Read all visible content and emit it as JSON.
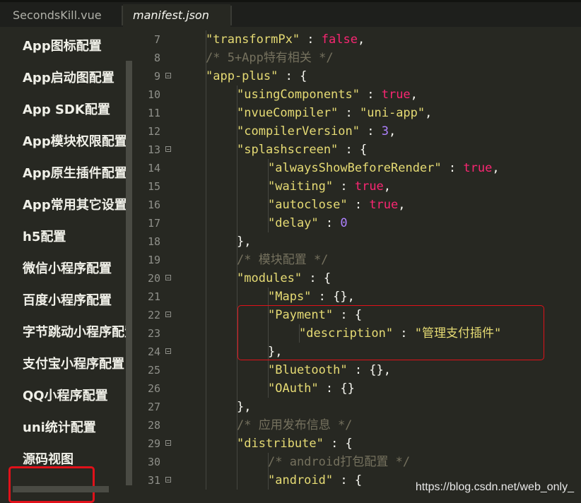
{
  "tabs": [
    {
      "label": "SecondsKill.vue",
      "active": false
    },
    {
      "label": "manifest.json",
      "active": true
    }
  ],
  "sidebar": {
    "items": [
      {
        "label": "App图标配置"
      },
      {
        "label": "App启动图配置"
      },
      {
        "label": "App SDK配置"
      },
      {
        "label": "App模块权限配置"
      },
      {
        "label": "App原生插件配置"
      },
      {
        "label": "App常用其它设置"
      },
      {
        "label": "h5配置"
      },
      {
        "label": "微信小程序配置"
      },
      {
        "label": "百度小程序配置"
      },
      {
        "label": "字节跳动小程序配置"
      },
      {
        "label": "支付宝小程序配置"
      },
      {
        "label": "QQ小程序配置"
      },
      {
        "label": "uni统计配置"
      },
      {
        "label": "源码视图",
        "selected": true
      }
    ]
  },
  "editor": {
    "lines": [
      {
        "num": "7",
        "fold": false,
        "tokens": [
          {
            "t": "\"transformPx\"",
            "c": "s"
          },
          {
            "t": " : ",
            "c": "p"
          },
          {
            "t": "false",
            "c": "k"
          },
          {
            "t": ",",
            "c": "p"
          }
        ],
        "indent": 1
      },
      {
        "num": "8",
        "fold": false,
        "tokens": [
          {
            "t": "/* 5+App特有相关 */",
            "c": "c"
          }
        ],
        "indent": 1
      },
      {
        "num": "9",
        "fold": true,
        "tokens": [
          {
            "t": "\"app-plus\"",
            "c": "s"
          },
          {
            "t": " : {",
            "c": "p"
          }
        ],
        "indent": 1
      },
      {
        "num": "10",
        "fold": false,
        "tokens": [
          {
            "t": "\"usingComponents\"",
            "c": "s"
          },
          {
            "t": " : ",
            "c": "p"
          },
          {
            "t": "true",
            "c": "k"
          },
          {
            "t": ",",
            "c": "p"
          }
        ],
        "indent": 2
      },
      {
        "num": "11",
        "fold": false,
        "tokens": [
          {
            "t": "\"nvueCompiler\"",
            "c": "s"
          },
          {
            "t": " : ",
            "c": "p"
          },
          {
            "t": "\"uni-app\"",
            "c": "s"
          },
          {
            "t": ",",
            "c": "p"
          }
        ],
        "indent": 2
      },
      {
        "num": "12",
        "fold": false,
        "tokens": [
          {
            "t": "\"compilerVersion\"",
            "c": "s"
          },
          {
            "t": " : ",
            "c": "p"
          },
          {
            "t": "3",
            "c": "n"
          },
          {
            "t": ",",
            "c": "p"
          }
        ],
        "indent": 2
      },
      {
        "num": "13",
        "fold": true,
        "tokens": [
          {
            "t": "\"splashscreen\"",
            "c": "s"
          },
          {
            "t": " : {",
            "c": "p"
          }
        ],
        "indent": 2
      },
      {
        "num": "14",
        "fold": false,
        "tokens": [
          {
            "t": "\"alwaysShowBeforeRender\"",
            "c": "s"
          },
          {
            "t": " : ",
            "c": "p"
          },
          {
            "t": "true",
            "c": "k"
          },
          {
            "t": ",",
            "c": "p"
          }
        ],
        "indent": 3
      },
      {
        "num": "15",
        "fold": false,
        "tokens": [
          {
            "t": "\"waiting\"",
            "c": "s"
          },
          {
            "t": " : ",
            "c": "p"
          },
          {
            "t": "true",
            "c": "k"
          },
          {
            "t": ",",
            "c": "p"
          }
        ],
        "indent": 3
      },
      {
        "num": "16",
        "fold": false,
        "tokens": [
          {
            "t": "\"autoclose\"",
            "c": "s"
          },
          {
            "t": " : ",
            "c": "p"
          },
          {
            "t": "true",
            "c": "k"
          },
          {
            "t": ",",
            "c": "p"
          }
        ],
        "indent": 3
      },
      {
        "num": "17",
        "fold": false,
        "tokens": [
          {
            "t": "\"delay\"",
            "c": "s"
          },
          {
            "t": " : ",
            "c": "p"
          },
          {
            "t": "0",
            "c": "n"
          }
        ],
        "indent": 3
      },
      {
        "num": "18",
        "fold": false,
        "tokens": [
          {
            "t": "},",
            "c": "p"
          }
        ],
        "indent": 2
      },
      {
        "num": "19",
        "fold": false,
        "tokens": [
          {
            "t": "/* 模块配置 */",
            "c": "c"
          }
        ],
        "indent": 2
      },
      {
        "num": "20",
        "fold": true,
        "tokens": [
          {
            "t": "\"modules\"",
            "c": "s"
          },
          {
            "t": " : {",
            "c": "p"
          }
        ],
        "indent": 2
      },
      {
        "num": "21",
        "fold": false,
        "tokens": [
          {
            "t": "\"Maps\"",
            "c": "s"
          },
          {
            "t": " : {},",
            "c": "p"
          }
        ],
        "indent": 3
      },
      {
        "num": "22",
        "fold": true,
        "tokens": [
          {
            "t": "\"Payment\"",
            "c": "s"
          },
          {
            "t": " : {",
            "c": "p"
          }
        ],
        "indent": 3
      },
      {
        "num": "23",
        "fold": false,
        "tokens": [
          {
            "t": "\"description\"",
            "c": "s"
          },
          {
            "t": " : ",
            "c": "p"
          },
          {
            "t": "\"管理支付插件\"",
            "c": "s"
          }
        ],
        "indent": 4
      },
      {
        "num": "24",
        "fold": true,
        "tokens": [
          {
            "t": "},",
            "c": "p"
          }
        ],
        "indent": 3
      },
      {
        "num": "25",
        "fold": false,
        "tokens": [
          {
            "t": "\"Bluetooth\"",
            "c": "s"
          },
          {
            "t": " : {},",
            "c": "p"
          }
        ],
        "indent": 3
      },
      {
        "num": "26",
        "fold": false,
        "tokens": [
          {
            "t": "\"OAuth\"",
            "c": "s"
          },
          {
            "t": " : {}",
            "c": "p"
          }
        ],
        "indent": 3
      },
      {
        "num": "27",
        "fold": false,
        "tokens": [
          {
            "t": "},",
            "c": "p"
          }
        ],
        "indent": 2
      },
      {
        "num": "28",
        "fold": false,
        "tokens": [
          {
            "t": "/* 应用发布信息 */",
            "c": "c"
          }
        ],
        "indent": 2
      },
      {
        "num": "29",
        "fold": true,
        "tokens": [
          {
            "t": "\"distribute\"",
            "c": "s"
          },
          {
            "t": " : {",
            "c": "p"
          }
        ],
        "indent": 2
      },
      {
        "num": "30",
        "fold": false,
        "tokens": [
          {
            "t": "/* android打包配置 */",
            "c": "c"
          }
        ],
        "indent": 3
      },
      {
        "num": "31",
        "fold": true,
        "tokens": [
          {
            "t": "\"android\"",
            "c": "s"
          },
          {
            "t": " : {",
            "c": "p"
          }
        ],
        "indent": 3
      }
    ]
  },
  "watermark": "https://blog.csdn.net/web_only_",
  "colors": {
    "background": "#272822",
    "string": "#e6db74",
    "keyword": "#f92672",
    "number": "#ae81ff",
    "comment": "#75715e",
    "highlight": "#e0111a"
  }
}
